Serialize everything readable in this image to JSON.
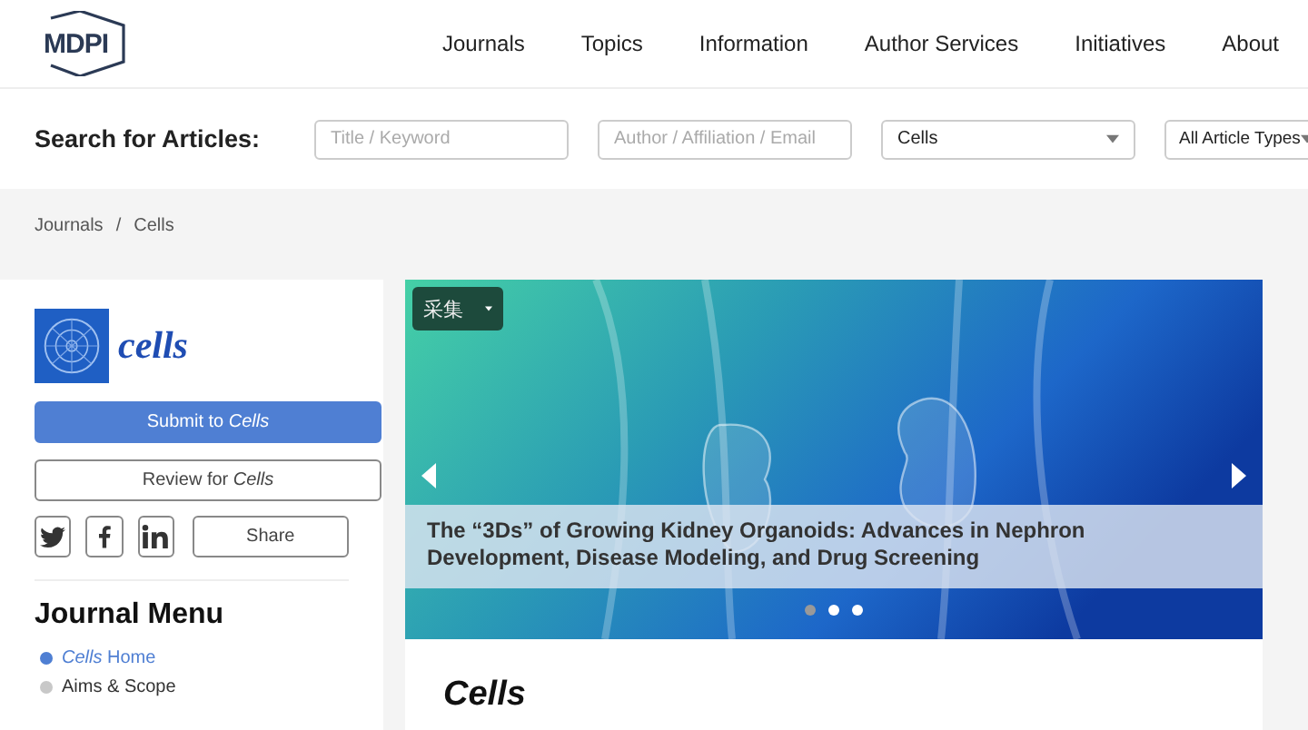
{
  "header": {
    "logo": "MDPI",
    "nav": [
      "Journals",
      "Topics",
      "Information",
      "Author Services",
      "Initiatives",
      "About"
    ]
  },
  "search": {
    "label": "Search for Articles:",
    "fields": [
      {
        "kind": "input",
        "placeholder": "Title / Keyword"
      },
      {
        "kind": "input",
        "placeholder": "Author / Affiliation / Email"
      },
      {
        "kind": "select",
        "value": "Cells"
      },
      {
        "kind": "select",
        "value": "All Article Types"
      }
    ]
  },
  "breadcrumb": {
    "separator": "/",
    "items": [
      "Journals",
      "Cells"
    ]
  },
  "sidebar": {
    "journal_name": "cells",
    "submit_button": "Submit to *Cells*",
    "review_button": "Review for *Cells*",
    "share_button": "Share",
    "menu_title": "Journal Menu",
    "menu_items": [
      {
        "label": "*Cells* Home",
        "selected": true
      },
      {
        "label": "Aims & Scope",
        "selected": false
      }
    ]
  },
  "carousel": {
    "overlay_button": "采集",
    "caption": "The “3Ds” of Growing Kidney Organoids: Advances in Nephron Development, Disease Modeling, and Drug Screening",
    "dots": [
      {
        "selected": true
      },
      {
        "selected": false
      },
      {
        "selected": false
      }
    ]
  },
  "main": {
    "title": "Cells"
  }
}
